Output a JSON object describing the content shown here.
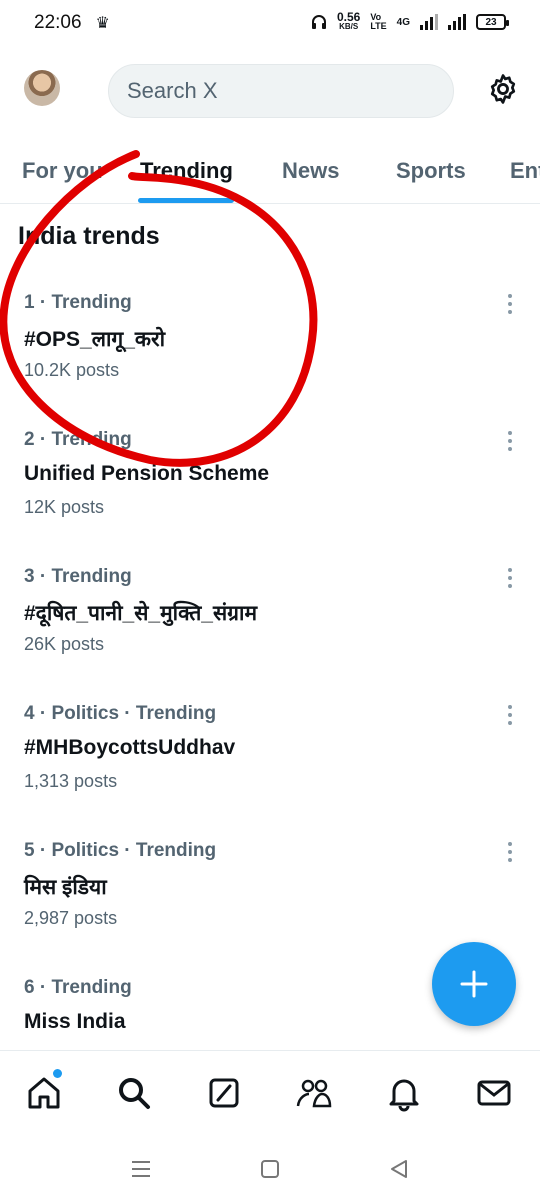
{
  "status": {
    "time": "22:06",
    "speed_value": "0.56",
    "speed_unit": "KB/S",
    "network_label": "4G",
    "battery": "23"
  },
  "header": {
    "search_placeholder": "Search X"
  },
  "tabs": [
    {
      "label": "For you"
    },
    {
      "label": "Trending"
    },
    {
      "label": "News"
    },
    {
      "label": "Sports"
    },
    {
      "label": "Ent"
    }
  ],
  "section": {
    "title": "India trends"
  },
  "trends": [
    {
      "meta": "1 · Trending",
      "name": "#OPS_लागू_करो",
      "count": "10.2K posts"
    },
    {
      "meta": "2 · Trending",
      "name": "Unified Pension Scheme",
      "count": "12K posts"
    },
    {
      "meta": "3 · Trending",
      "name": "#दूषित_पानी_से_मुक्ति_संग्राम",
      "count": "26K posts"
    },
    {
      "meta": "4 · Politics · Trending",
      "name": "#MHBoycottsUddhav",
      "count": "1,313 posts"
    },
    {
      "meta": "5 · Politics · Trending",
      "name": "मिस इंडिया",
      "count": "2,987 posts"
    },
    {
      "meta": "6 · Trending",
      "name": "Miss India",
      "count": ""
    }
  ],
  "colors": {
    "accent": "#1d9bf0",
    "annotation": "#e00000",
    "secondary_text": "#536471"
  },
  "icons": [
    "gear-icon",
    "plus-icon",
    "home-icon",
    "search-icon",
    "grok-icon",
    "communities-icon",
    "bell-icon",
    "mail-icon"
  ]
}
